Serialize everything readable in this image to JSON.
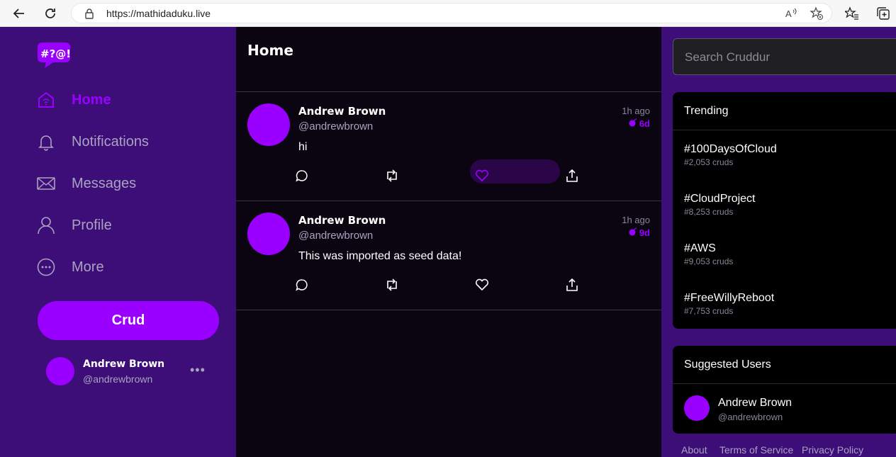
{
  "browser": {
    "url": "https://mathidaduku.live"
  },
  "sidebar": {
    "logo_text": "#?@!",
    "items": [
      {
        "label": "Home",
        "icon": "home-icon",
        "active": true
      },
      {
        "label": "Notifications",
        "icon": "bell-icon",
        "active": false
      },
      {
        "label": "Messages",
        "icon": "envelope-icon",
        "active": false
      },
      {
        "label": "Profile",
        "icon": "person-icon",
        "active": false
      },
      {
        "label": "More",
        "icon": "more-circle-icon",
        "active": false
      }
    ],
    "crud_label": "Crud",
    "user": {
      "name": "Andrew Brown",
      "handle": "@andrewbrown",
      "menu": "•••"
    }
  },
  "main": {
    "title": "Home",
    "posts": [
      {
        "name": "Andrew Brown",
        "handle": "@andrewbrown",
        "text": "hi",
        "time": "1h ago",
        "expires": "6d"
      },
      {
        "name": "Andrew Brown",
        "handle": "@andrewbrown",
        "text": "This was imported as seed data!",
        "time": "1h ago",
        "expires": "9d"
      }
    ]
  },
  "right": {
    "search_placeholder": "Search Cruddur",
    "trending": {
      "title": "Trending",
      "items": [
        {
          "tag": "#100DaysOfCloud",
          "count": "#2,053 cruds"
        },
        {
          "tag": "#CloudProject",
          "count": "#8,253 cruds"
        },
        {
          "tag": "#AWS",
          "count": "#9,053 cruds"
        },
        {
          "tag": "#FreeWillyReboot",
          "count": "#7,753 cruds"
        }
      ]
    },
    "suggested": {
      "title": "Suggested Users",
      "user": {
        "name": "Andrew Brown",
        "handle": "@andrewbrown"
      }
    },
    "footer": [
      "About",
      "Terms of Service",
      "Privacy Policy"
    ]
  },
  "colors": {
    "accent": "#9a00ff",
    "sidebar_bg": "#3d0e78",
    "feed_bg": "#0a0510"
  }
}
